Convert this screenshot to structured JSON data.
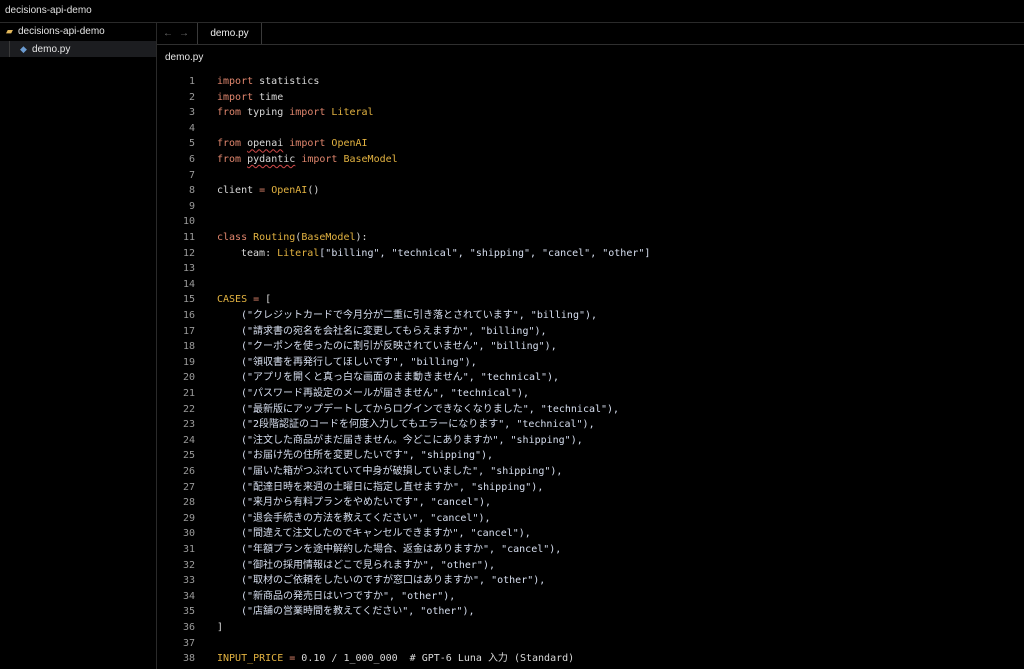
{
  "window": {
    "title": "decisions-api-demo"
  },
  "sidebar": {
    "root_label": "decisions-api-demo",
    "root_icon": "folder-icon",
    "items": [
      {
        "label": "demo.py",
        "icon": "python-file-icon"
      }
    ]
  },
  "tabs": {
    "back": "←",
    "forward": "→",
    "active_label": "demo.py"
  },
  "breadcrumb": "demo.py",
  "colors": {
    "keyword": "#e0866d",
    "class": "#e3b341",
    "text": "#d9d9d9",
    "background": "#000000"
  },
  "editor": {
    "lines": [
      {
        "n": "1",
        "segs": [
          [
            "kw",
            "import"
          ],
          [
            "",
            "statistics"
          ]
        ]
      },
      {
        "n": "2",
        "segs": [
          [
            "kw",
            "import"
          ],
          [
            "",
            "time"
          ]
        ]
      },
      {
        "n": "3",
        "segs": [
          [
            "kw",
            "from"
          ],
          [
            "",
            " typing "
          ],
          [
            "kw",
            "import"
          ],
          [
            "cls",
            " Literal"
          ]
        ]
      },
      {
        "n": "4",
        "segs": []
      },
      {
        "n": "5",
        "segs": [
          [
            "kw",
            "from"
          ],
          [
            "",
            " "
          ],
          [
            "under",
            "openai"
          ],
          [
            "",
            " "
          ],
          [
            "kw",
            "import"
          ],
          [
            "cls",
            " OpenAI"
          ]
        ]
      },
      {
        "n": "6",
        "segs": [
          [
            "kw",
            "from"
          ],
          [
            "",
            " "
          ],
          [
            "under",
            "pydantic"
          ],
          [
            "",
            " "
          ],
          [
            "kw",
            "import"
          ],
          [
            "cls",
            " BaseModel"
          ]
        ]
      },
      {
        "n": "7",
        "segs": []
      },
      {
        "n": "8",
        "segs": [
          [
            "",
            "client "
          ],
          [
            "kw",
            "="
          ],
          [
            "cls",
            " OpenAI"
          ],
          [
            "",
            "()"
          ]
        ]
      },
      {
        "n": "9",
        "segs": []
      },
      {
        "n": "10",
        "segs": []
      },
      {
        "n": "11",
        "segs": [
          [
            "kw",
            "class"
          ],
          [
            "cls",
            " Routing"
          ],
          [
            "",
            "("
          ],
          [
            "cls",
            "BaseModel"
          ],
          [
            "",
            "):"
          ]
        ]
      },
      {
        "n": "12",
        "ind": true,
        "segs": [
          [
            "",
            "team: "
          ],
          [
            "cls",
            "Literal"
          ],
          [
            "str",
            "[\"billing\", \"technical\", \"shipping\", \"cancel\", \"other\"]"
          ]
        ]
      },
      {
        "n": "13",
        "segs": []
      },
      {
        "n": "14",
        "segs": []
      },
      {
        "n": "15",
        "segs": [
          [
            "cls",
            "CASES"
          ],
          [
            "kw",
            " ="
          ],
          [
            "",
            " ["
          ]
        ]
      },
      {
        "n": "16",
        "ind": true,
        "segs": [
          [
            "str",
            "(\"クレジットカードで今月分が二重に引き落とされています\", \"billing\"),"
          ]
        ]
      },
      {
        "n": "17",
        "ind": true,
        "segs": [
          [
            "str",
            "(\"請求書の宛名を会社名に変更してもらえますか\", \"billing\"),"
          ]
        ]
      },
      {
        "n": "18",
        "ind": true,
        "segs": [
          [
            "str",
            "(\"クーポンを使ったのに割引が反映されていません\", \"billing\"),"
          ]
        ]
      },
      {
        "n": "19",
        "ind": true,
        "segs": [
          [
            "str",
            "(\"領収書を再発行してほしいです\", \"billing\"),"
          ]
        ]
      },
      {
        "n": "20",
        "ind": true,
        "segs": [
          [
            "str",
            "(\"アプリを開くと真っ白な画面のまま動きません\", \"technical\"),"
          ]
        ]
      },
      {
        "n": "21",
        "ind": true,
        "segs": [
          [
            "str",
            "(\"パスワード再設定のメールが届きません\", \"technical\"),"
          ]
        ]
      },
      {
        "n": "22",
        "ind": true,
        "segs": [
          [
            "str",
            "(\"最新版にアップデートしてからログインできなくなりました\", \"technical\"),"
          ]
        ]
      },
      {
        "n": "23",
        "ind": true,
        "segs": [
          [
            "str",
            "(\"2段階認証のコードを何度入力してもエラーになります\", \"technical\"),"
          ]
        ]
      },
      {
        "n": "24",
        "ind": true,
        "segs": [
          [
            "str",
            "(\"注文した商品がまだ届きません。今どこにありますか\", \"shipping\"),"
          ]
        ]
      },
      {
        "n": "25",
        "ind": true,
        "segs": [
          [
            "str",
            "(\"お届け先の住所を変更したいです\", \"shipping\"),"
          ]
        ]
      },
      {
        "n": "26",
        "ind": true,
        "segs": [
          [
            "str",
            "(\"届いた箱がつぶれていて中身が破損していました\", \"shipping\"),"
          ]
        ]
      },
      {
        "n": "27",
        "ind": true,
        "segs": [
          [
            "str",
            "(\"配達日時を来週の土曜日に指定し直せますか\", \"shipping\"),"
          ]
        ]
      },
      {
        "n": "28",
        "ind": true,
        "segs": [
          [
            "str",
            "(\"来月から有料プランをやめたいです\", \"cancel\"),"
          ]
        ]
      },
      {
        "n": "29",
        "ind": true,
        "segs": [
          [
            "str",
            "(\"退会手続きの方法を教えてください\", \"cancel\"),"
          ]
        ]
      },
      {
        "n": "30",
        "ind": true,
        "segs": [
          [
            "str",
            "(\"間違えて注文したのでキャンセルできますか\", \"cancel\"),"
          ]
        ]
      },
      {
        "n": "31",
        "ind": true,
        "segs": [
          [
            "str",
            "(\"年額プランを途中解約した場合、返金はありますか\", \"cancel\"),"
          ]
        ]
      },
      {
        "n": "32",
        "ind": true,
        "segs": [
          [
            "str",
            "(\"御社の採用情報はどこで見られますか\", \"other\"),"
          ]
        ]
      },
      {
        "n": "33",
        "ind": true,
        "segs": [
          [
            "str",
            "(\"取材のご依頼をしたいのですが窓口はありますか\", \"other\"),"
          ]
        ]
      },
      {
        "n": "34",
        "ind": true,
        "segs": [
          [
            "str",
            "(\"新商品の発売日はいつですか\", \"other\"),"
          ]
        ]
      },
      {
        "n": "35",
        "ind": true,
        "segs": [
          [
            "str",
            "(\"店舗の営業時間を教えてください\", \"other\"),"
          ]
        ]
      },
      {
        "n": "36",
        "segs": [
          [
            "",
            "]"
          ]
        ]
      },
      {
        "n": "37",
        "segs": []
      },
      {
        "n": "38",
        "segs": [
          [
            "cls",
            "INPUT_PRICE"
          ],
          [
            "kw",
            " ="
          ],
          [
            "",
            " 0.10 / 1_000_000  # GPT-6 Luna 入力 (Standard)"
          ]
        ]
      }
    ]
  }
}
